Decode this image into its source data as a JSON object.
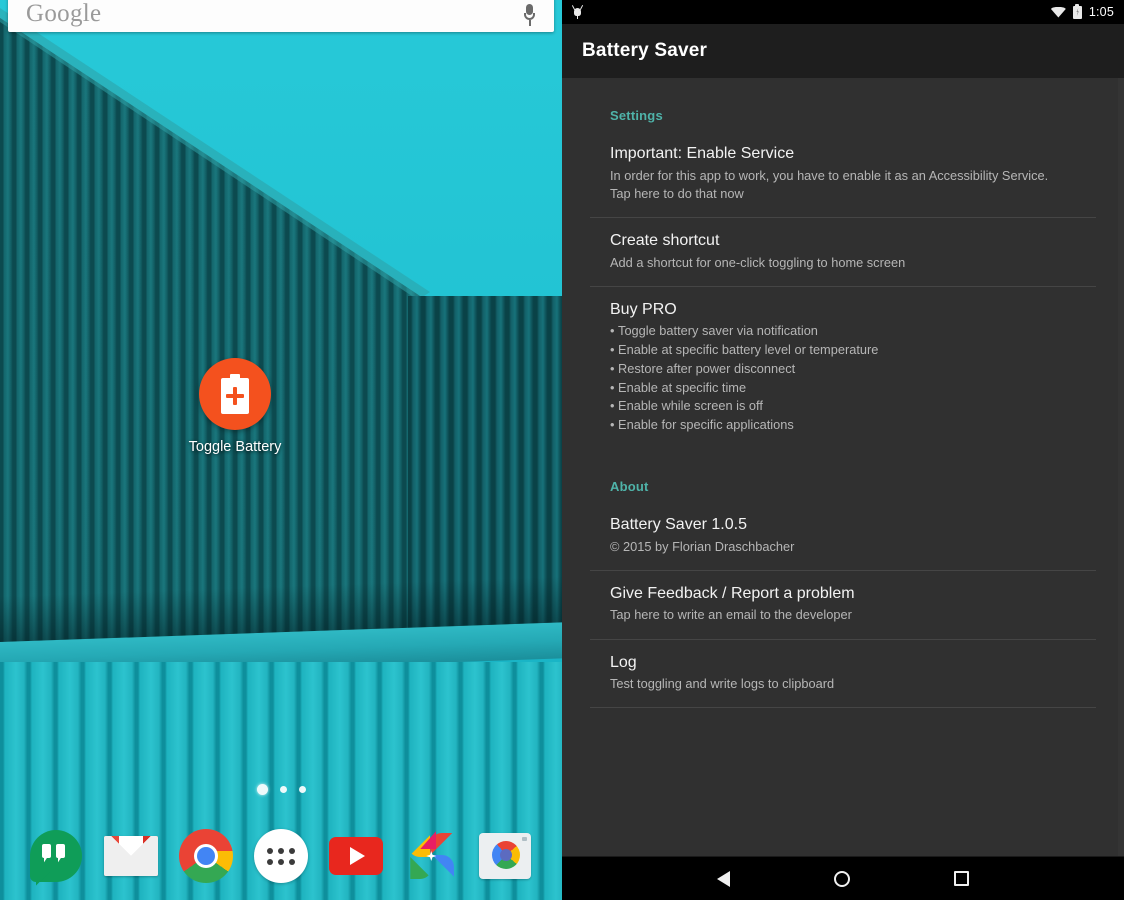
{
  "homescreen": {
    "search": {
      "logo_text": "Google",
      "mic_icon": "microphone-icon"
    },
    "shortcut": {
      "label": "Toggle Battery",
      "icon": "battery-plus-icon"
    },
    "page_dots": {
      "count": 3,
      "active_index": 0
    },
    "dock": [
      {
        "name": "hangouts",
        "label": "Hangouts"
      },
      {
        "name": "gmail",
        "label": "Gmail"
      },
      {
        "name": "chrome",
        "label": "Chrome"
      },
      {
        "name": "app-drawer",
        "label": "Apps"
      },
      {
        "name": "youtube",
        "label": "YouTube"
      },
      {
        "name": "photos",
        "label": "Photos"
      },
      {
        "name": "camera",
        "label": "Camera"
      }
    ]
  },
  "app": {
    "statusbar": {
      "adb_icon": "android-debug-icon",
      "wifi_icon": "wifi-icon",
      "battery_icon": "battery-charging-icon",
      "time": "1:05"
    },
    "actionbar": {
      "title": "Battery Saver"
    },
    "sections": [
      {
        "header": "Settings",
        "items": [
          {
            "title": "Important: Enable Service",
            "summary": "In order for this app to work, you have to enable it as an Accessibility Service. Tap here to do that now"
          },
          {
            "title": "Create shortcut",
            "summary": "Add a shortcut for one-click toggling to home screen"
          },
          {
            "title": "Buy PRO",
            "bullets": [
              "Toggle battery saver via notification",
              "Enable at specific battery level or temperature",
              "Restore after power disconnect",
              "Enable at specific time",
              "Enable while screen is off",
              "Enable for specific applications"
            ]
          }
        ]
      },
      {
        "header": "About",
        "items": [
          {
            "title": "Battery Saver 1.0.5",
            "summary": "© 2015 by Florian Draschbacher"
          },
          {
            "title": "Give Feedback / Report a problem",
            "summary": "Tap here to write an email to the developer"
          },
          {
            "title": "Log",
            "summary": "Test toggling and write logs to clipboard"
          }
        ]
      }
    ],
    "navbar": {
      "back_icon": "back-triangle-icon",
      "home_icon": "home-circle-icon",
      "recents_icon": "recents-square-icon"
    },
    "colors": {
      "accent": "#4fb3a9",
      "background": "#303030",
      "actionbar": "#1e1e1e"
    }
  }
}
